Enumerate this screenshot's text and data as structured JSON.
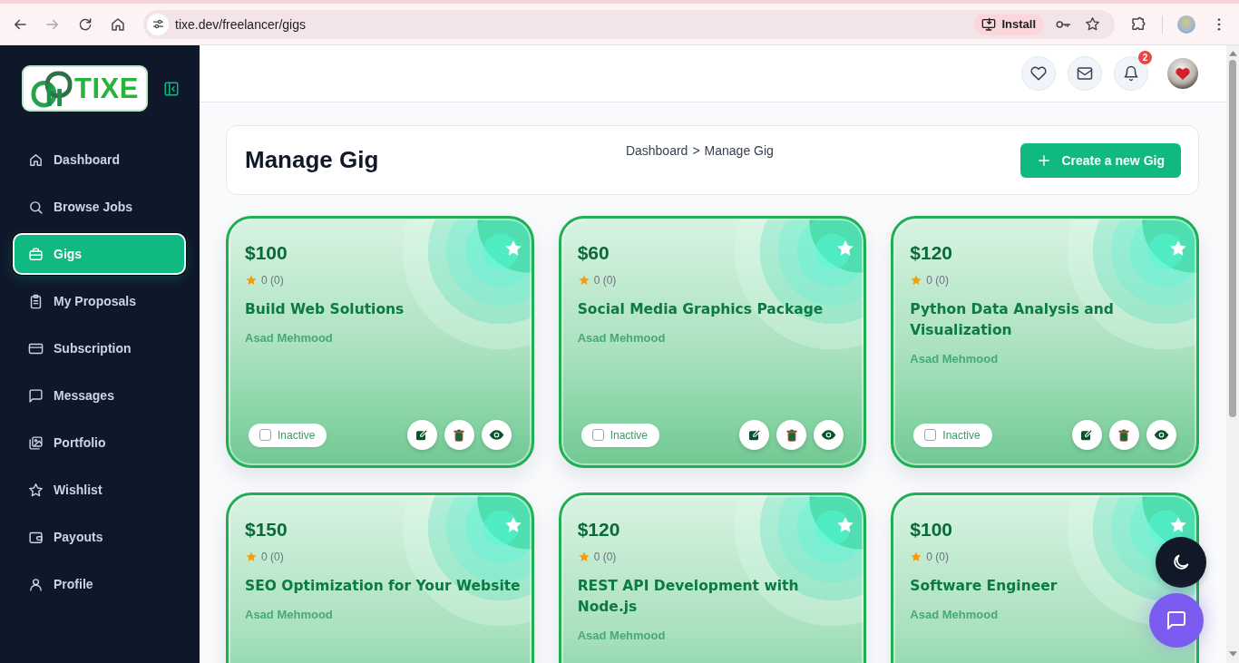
{
  "browser": {
    "url": "tixe.dev/freelancer/gigs",
    "install_label": "Install",
    "forward_enabled": false
  },
  "sidebar": {
    "logo_text": "TIXE",
    "items": [
      {
        "label": "Dashboard",
        "selected": false
      },
      {
        "label": "Browse Jobs",
        "selected": false
      },
      {
        "label": "Gigs",
        "selected": true
      },
      {
        "label": "My Proposals",
        "selected": false
      },
      {
        "label": "Subscription",
        "selected": false
      },
      {
        "label": "Messages",
        "selected": false
      },
      {
        "label": "Portfolio",
        "selected": false
      },
      {
        "label": "Wishlist",
        "selected": false
      },
      {
        "label": "Payouts",
        "selected": false
      },
      {
        "label": "Profile",
        "selected": false
      }
    ]
  },
  "header": {
    "notification_count": "2"
  },
  "page": {
    "title": "Manage Gig",
    "breadcrumb": {
      "items": [
        "Dashboard",
        "Manage Gig"
      ],
      "separator": ">"
    },
    "create_button": "Create a new Gig"
  },
  "gigs": [
    {
      "price": "$100",
      "rating": "0 (0)",
      "title": "Build Web Solutions",
      "author": "Asad Mehmood",
      "status": {
        "label": "Inactive",
        "checked": false
      }
    },
    {
      "price": "$60",
      "rating": "0 (0)",
      "title": "Social Media Graphics Package",
      "author": "Asad Mehmood",
      "status": {
        "label": "Inactive",
        "checked": false
      }
    },
    {
      "price": "$120",
      "rating": "0 (0)",
      "title": "Python Data Analysis and Visualization",
      "author": "Asad Mehmood",
      "status": {
        "label": "Inactive",
        "checked": false
      }
    },
    {
      "price": "$150",
      "rating": "0 (0)",
      "title": "SEO Optimization for Your Website",
      "author": "Asad Mehmood"
    },
    {
      "price": "$120",
      "rating": "0 (0)",
      "title": "REST API Development with Node.js",
      "author": "Asad Mehmood"
    },
    {
      "price": "$100",
      "rating": "0 (0)",
      "title": "Software Engineer",
      "author": "Asad Mehmood"
    }
  ]
}
